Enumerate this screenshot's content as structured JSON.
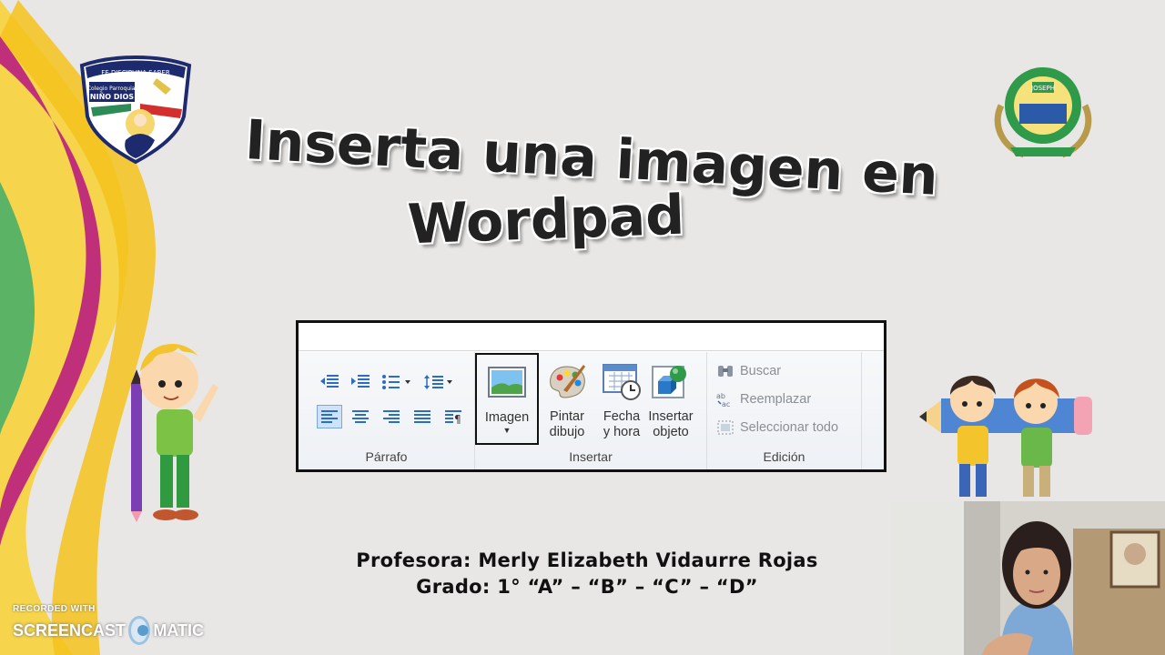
{
  "slide": {
    "title_line1": "Inserta una imagen en",
    "title_line2": "Wordpad"
  },
  "logos": {
    "left_crest_motto": "FE DISCIPLINA SABER",
    "left_crest_line1": "Colegio Parroquial",
    "left_crest_line2": "NIÑO DIOS",
    "right_crest_text": "JOSEPH"
  },
  "ribbon": {
    "groups": [
      {
        "label": "Párrafo"
      },
      {
        "label": "Insertar"
      },
      {
        "label": "Edición"
      }
    ],
    "insertar_buttons": [
      {
        "label_line1": "Imagen",
        "label_line2": "",
        "selected": true
      },
      {
        "label_line1": "Pintar",
        "label_line2": "dibujo"
      },
      {
        "label_line1": "Fecha",
        "label_line2": "y hora"
      },
      {
        "label_line1": "Insertar",
        "label_line2": "objeto"
      }
    ],
    "edicion_items": [
      {
        "label": "Buscar",
        "icon": "binoculars-icon"
      },
      {
        "label": "Reemplazar",
        "icon": "replace-icon"
      },
      {
        "label": "Seleccionar todo",
        "icon": "select-all-icon"
      }
    ],
    "accent_color": "#2b6cc4"
  },
  "footer": {
    "teacher": "Profesora: Merly Elizabeth Vidaurre Rojas",
    "grade": "Grado: 1° “A” – “B” – “C” – “D”"
  },
  "watermark": {
    "recorded_with": "RECORDED WITH",
    "brand_left": "SCREENCAST",
    "brand_right": "MATIC"
  }
}
